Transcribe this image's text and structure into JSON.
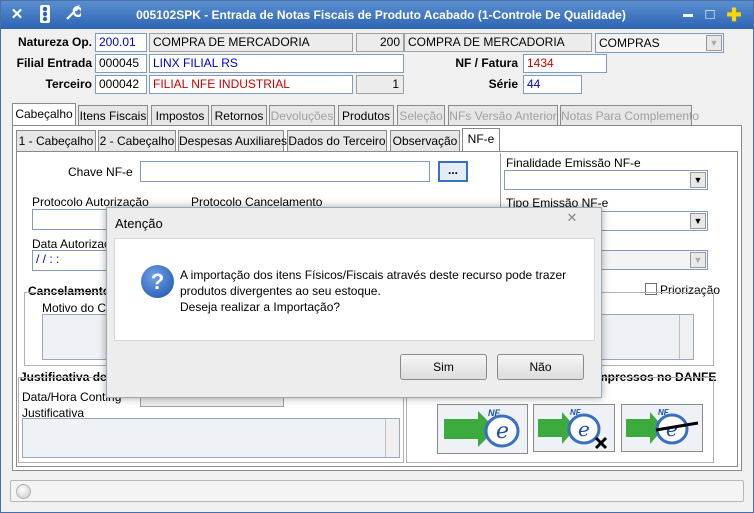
{
  "window": {
    "title": "005102SPK - Entrada de Notas Fiscais de Produto Acabado (1-Controle De Qualidade)",
    "close_symbol": "✕",
    "maximize_symbol": "□",
    "minimize_symbol": "▬",
    "add_symbol": "✚",
    "icons": [
      "close-icon",
      "traffic-light-icon",
      "wrench-icon",
      "minimize-icon",
      "maximize-icon",
      "add-icon"
    ]
  },
  "header": {
    "natureza_label": "Natureza Op.",
    "natureza_code": "200.01",
    "natureza_desc": "COMPRA DE MERCADORIA",
    "natureza_code2": "200",
    "natureza_desc2": "COMPRA DE MERCADORIA",
    "natureza_type": "COMPRAS",
    "filial_label": "Filial Entrada",
    "filial_code": "000045",
    "filial_name": "LINX FILIAL RS",
    "terceiro_label": "Terceiro",
    "terceiro_code": "000042",
    "terceiro_name": "FILIAL NFE INDUSTRIAL",
    "terceiro_count": "1",
    "nf_label": "NF / Fatura",
    "nf_value": "1434",
    "serie_label": "Série",
    "serie_value": "44"
  },
  "main_tabs": [
    {
      "label": "Cabeçalho",
      "state": "active"
    },
    {
      "label": "Itens Fiscais",
      "state": "normal"
    },
    {
      "label": "Impostos",
      "state": "normal"
    },
    {
      "label": "Retornos",
      "state": "normal"
    },
    {
      "label": "Devoluções",
      "state": "disabled"
    },
    {
      "label": "Produtos",
      "state": "normal"
    },
    {
      "label": "Seleção",
      "state": "disabled"
    },
    {
      "label": "NFs Versão Anterior",
      "state": "disabled"
    },
    {
      "label": "Notas Para Complemento",
      "state": "disabled"
    }
  ],
  "sub_tabs": [
    {
      "label": "1 - Cabeçalho"
    },
    {
      "label": "2 - Cabeçalho"
    },
    {
      "label": "Despesas Auxiliares"
    },
    {
      "label": "Dados do Terceiro"
    },
    {
      "label": "Observação"
    },
    {
      "label": "NF-e"
    }
  ],
  "nfe": {
    "chave_label": "Chave NF-e",
    "chave_value": "",
    "ellipsis": "...",
    "protocolo_autorizacao_label": "Protocolo Autorização",
    "protocolo_cancelamento_label": "Protocolo Cancelamento",
    "data_autorizacao_label": "Data Autorizaç",
    "data_autorizacao_value": "/ /    : :",
    "finalidade_label": "Finalidade Emissão NF-e",
    "tipo_emissao_label": "Tipo Emissão NF-e",
    "priorizacao_label": "Priorização",
    "cancelamento_label": "Cancelamento",
    "motivo_label": "Motivo do Ca",
    "justificativa_section_label": "Justificativa de",
    "data_hora_label": "Data/Hora Conting",
    "justificativa_label": "Justificativa",
    "impressos_label": "mpressos no DANFE",
    "nfe_logo_text": "NF",
    "nfe_logo_e": "e"
  },
  "dialog": {
    "title": "Atenção",
    "close_symbol": "✕",
    "icon_symbol": "?",
    "message_line1": "A importação dos itens Físicos/Fiscais através deste recurso pode trazer",
    "message_line2": "produtos divergentes ao seu estoque.",
    "message_line3": "Deseja realizar a Importação?",
    "yes_label": "Sim",
    "no_label": "Não"
  },
  "colors": {
    "titlebar": "#2e64b4",
    "field_blue_text": "#0000cc",
    "field_red_text": "#cc0000",
    "nfe_arrow_green": "#3caa3c"
  }
}
